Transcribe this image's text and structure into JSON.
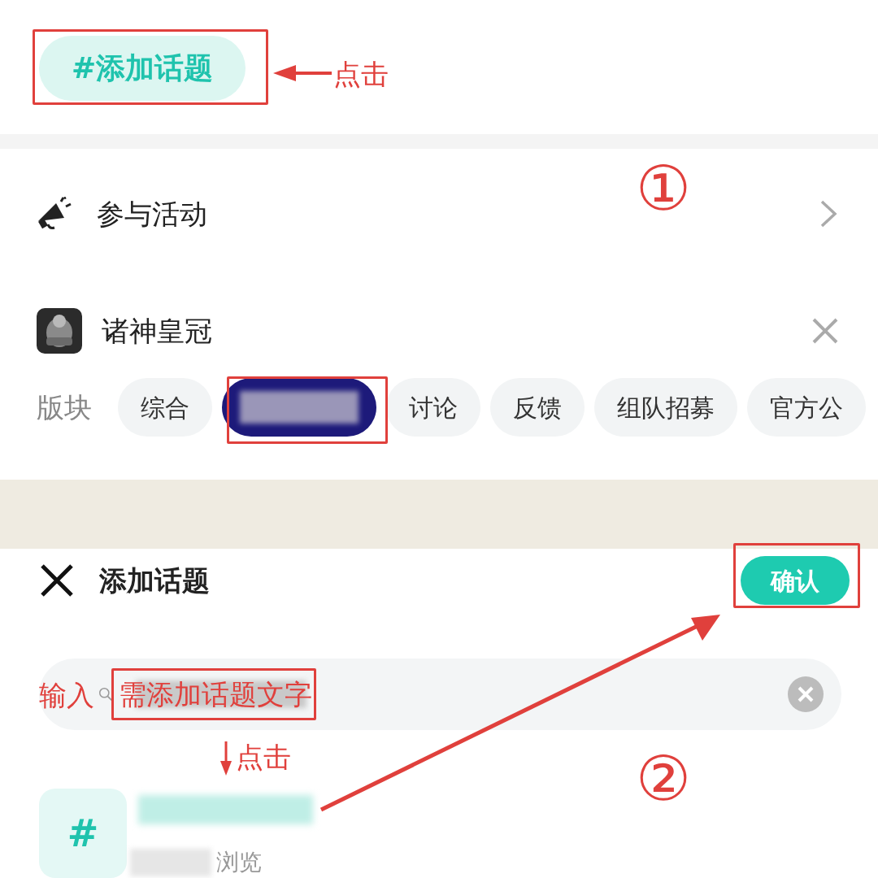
{
  "add_topic_button": {
    "hash": "#",
    "label": "添加话题"
  },
  "activity_row": {
    "label": "参与活动"
  },
  "game": {
    "name": "诸神皇冠"
  },
  "boards": {
    "label": "版块",
    "chips": [
      {
        "kind": "text",
        "label": "综合",
        "selected": false
      },
      {
        "kind": "blurred",
        "selected": true
      },
      {
        "kind": "text",
        "label": "讨论",
        "selected": false
      },
      {
        "kind": "text",
        "label": "反馈",
        "selected": false
      },
      {
        "kind": "text",
        "label": "组队招募",
        "selected": false
      },
      {
        "kind": "text",
        "label": "官方公",
        "selected": false
      }
    ]
  },
  "dialog": {
    "title": "添加话题",
    "confirm": "确认",
    "results": [
      {
        "hash": "#",
        "meta": "浏览"
      }
    ]
  },
  "annotations": {
    "click_1": "点击",
    "step_1": "①",
    "input": "输入",
    "input_hint": "需添加话题文字",
    "click_2": "点击",
    "step_2": "②"
  }
}
